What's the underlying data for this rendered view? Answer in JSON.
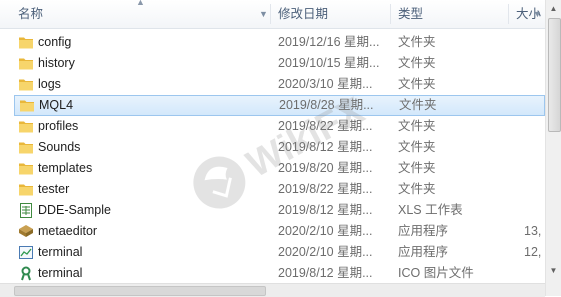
{
  "columns": {
    "name": "名称",
    "modified": "修改日期",
    "type": "类型",
    "size": "大小"
  },
  "files": [
    {
      "name": "config",
      "date": "2019/12/16 星期...",
      "type": "文件夹",
      "size": "",
      "icon": "folder-icon"
    },
    {
      "name": "history",
      "date": "2019/10/15 星期...",
      "type": "文件夹",
      "size": "",
      "icon": "folder-icon"
    },
    {
      "name": "logs",
      "date": "2020/3/10 星期...",
      "type": "文件夹",
      "size": "",
      "icon": "folder-icon"
    },
    {
      "name": "MQL4",
      "date": "2019/8/28 星期...",
      "type": "文件夹",
      "size": "",
      "icon": "folder-icon",
      "selected": true
    },
    {
      "name": "profiles",
      "date": "2019/8/22 星期...",
      "type": "文件夹",
      "size": "",
      "icon": "folder-icon"
    },
    {
      "name": "Sounds",
      "date": "2019/8/12 星期...",
      "type": "文件夹",
      "size": "",
      "icon": "folder-icon"
    },
    {
      "name": "templates",
      "date": "2019/8/20 星期...",
      "type": "文件夹",
      "size": "",
      "icon": "folder-icon"
    },
    {
      "name": "tester",
      "date": "2019/8/22 星期...",
      "type": "文件夹",
      "size": "",
      "icon": "folder-icon"
    },
    {
      "name": "DDE-Sample",
      "date": "2019/8/12 星期...",
      "type": "XLS 工作表",
      "size": "",
      "icon": "spreadsheet-icon"
    },
    {
      "name": "metaeditor",
      "date": "2020/2/10 星期...",
      "type": "应用程序",
      "size": "13,",
      "icon": "metaeditor-icon"
    },
    {
      "name": "terminal",
      "date": "2020/2/10 星期...",
      "type": "应用程序",
      "size": "12,",
      "icon": "chart-app-icon"
    },
    {
      "name": "terminal",
      "date": "2019/8/12 星期...",
      "type": "ICO 图片文件",
      "size": "",
      "icon": "ico-file-icon"
    }
  ],
  "watermark": {
    "text": "WikiFX",
    "color": "#8a8a8a"
  },
  "colors": {
    "folder": "#f2c94c",
    "selection": "#d3e8fb",
    "header_text": "#4c607a",
    "meta_text": "#6d6d6d"
  }
}
